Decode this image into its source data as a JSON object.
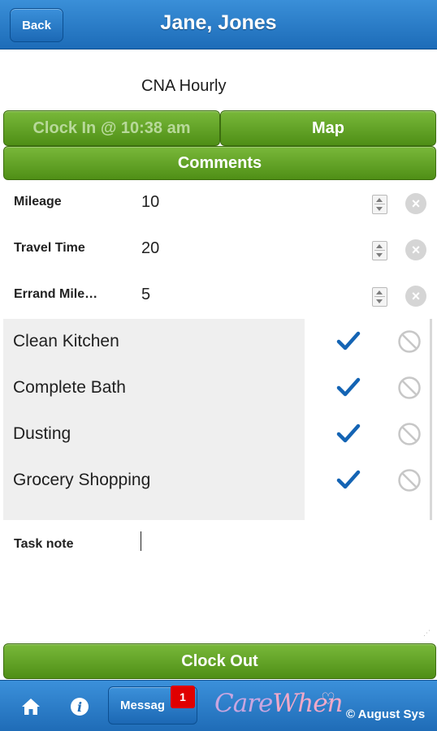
{
  "header": {
    "back_label": "Back",
    "title": "Jane, Jones"
  },
  "subtitle": "CNA Hourly",
  "actions": {
    "clock_in": "Clock In @ 10:38 am",
    "map": "Map",
    "comments": "Comments",
    "clock_out": "Clock Out"
  },
  "fields": [
    {
      "label": "Mileage",
      "value": "10"
    },
    {
      "label": "Travel Time",
      "value": "20"
    },
    {
      "label": "Errand Mile…",
      "value": "5"
    }
  ],
  "tasks": [
    {
      "label": "Clean Kitchen",
      "done": true
    },
    {
      "label": "Complete Bath",
      "done": true
    },
    {
      "label": "Dusting",
      "done": true
    },
    {
      "label": "Grocery Shopping",
      "done": true
    }
  ],
  "task_note_label": "Task note",
  "footer": {
    "messages_label": "Messag",
    "messages_badge": "1",
    "logo_care": "Care",
    "logo_when": "When",
    "copyright": "© August Sys"
  },
  "colors": {
    "header_blue": "#1d6cb8",
    "button_green": "#5f9e22",
    "check_blue": "#1464b4",
    "badge_red": "#e00000"
  },
  "icons": {
    "home": "home-icon",
    "info": "info-icon",
    "check": "check-icon",
    "not_done": "no-entry-icon",
    "clear": "clear-icon",
    "spinner": "spinner-icon"
  }
}
